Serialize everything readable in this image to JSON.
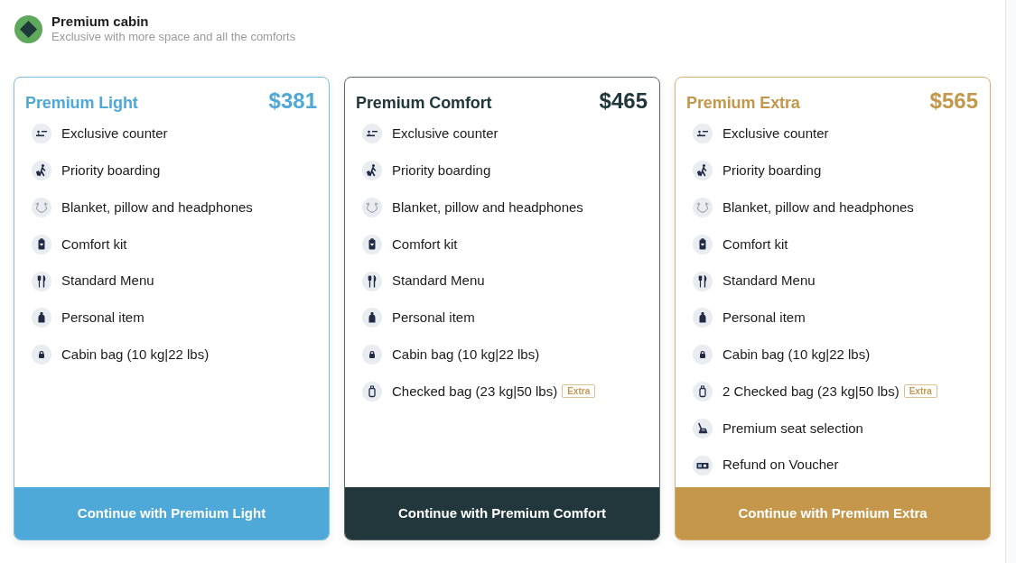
{
  "header": {
    "title": "Premium cabin",
    "subtitle": "Exclusive with more space and all the comforts"
  },
  "plans": [
    {
      "name": "Premium Light",
      "price": "$381",
      "color": "#4ea8d8",
      "features": [
        {
          "kind": "counter",
          "label": "Exclusive counter"
        },
        {
          "kind": "boarding",
          "label": "Priority boarding"
        },
        {
          "kind": "headphones",
          "label": "Blanket, pillow and headphones"
        },
        {
          "kind": "kit",
          "label": "Comfort kit"
        },
        {
          "kind": "menu",
          "label": "Standard Menu"
        },
        {
          "kind": "personal",
          "label": "Personal item"
        },
        {
          "kind": "cabin-bag",
          "label": "Cabin bag (10 kg|22 lbs)"
        }
      ],
      "button": "Continue with Premium Light"
    },
    {
      "name": "Premium Comfort",
      "price": "$465",
      "color": "#21373b",
      "features": [
        {
          "kind": "counter",
          "label": "Exclusive counter"
        },
        {
          "kind": "boarding",
          "label": "Priority boarding"
        },
        {
          "kind": "headphones",
          "label": "Blanket, pillow and headphones"
        },
        {
          "kind": "kit",
          "label": "Comfort kit"
        },
        {
          "kind": "menu",
          "label": "Standard Menu"
        },
        {
          "kind": "personal",
          "label": "Personal item"
        },
        {
          "kind": "cabin-bag",
          "label": "Cabin bag (10 kg|22 lbs)"
        },
        {
          "kind": "checked-bag",
          "label": "Checked bag (23 kg|50 lbs)",
          "tag": "Extra"
        }
      ],
      "button": "Continue with Premium Comfort"
    },
    {
      "name": "Premium Extra",
      "price": "$565",
      "color": "#c4974b",
      "features": [
        {
          "kind": "counter",
          "label": "Exclusive counter"
        },
        {
          "kind": "boarding",
          "label": "Priority boarding"
        },
        {
          "kind": "headphones",
          "label": "Blanket, pillow and headphones"
        },
        {
          "kind": "kit",
          "label": "Comfort kit"
        },
        {
          "kind": "menu",
          "label": "Standard Menu"
        },
        {
          "kind": "personal",
          "label": "Personal item"
        },
        {
          "kind": "cabin-bag",
          "label": "Cabin bag (10 kg|22 lbs)"
        },
        {
          "kind": "checked-bag",
          "label": "2 Checked bag (23 kg|50 lbs)",
          "tag": "Extra"
        },
        {
          "kind": "seat",
          "label": "Premium seat selection"
        },
        {
          "kind": "voucher",
          "label": "Refund on Voucher"
        }
      ],
      "button": "Continue with Premium Extra"
    }
  ]
}
